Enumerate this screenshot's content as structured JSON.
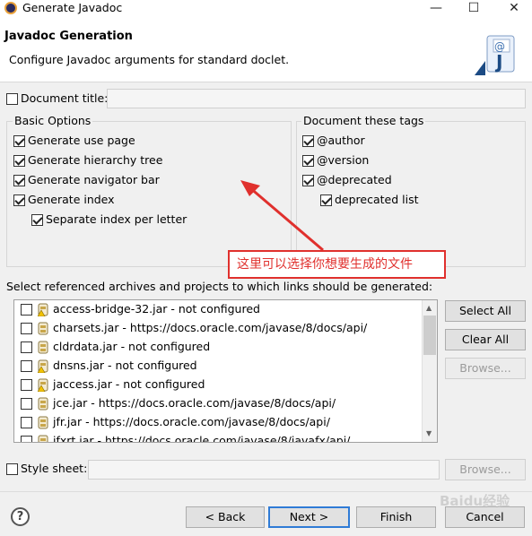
{
  "window": {
    "title": "Generate Javadoc",
    "minimize": "—",
    "maximize": "☐",
    "close": "✕"
  },
  "header": {
    "title": "Javadoc Generation",
    "description": "Configure Javadoc arguments for standard doclet."
  },
  "doc_title": {
    "label": "Document title:",
    "value": ""
  },
  "basic_options": {
    "legend": "Basic Options",
    "items": [
      {
        "label": "Generate use page",
        "checked": true
      },
      {
        "label": "Generate hierarchy tree",
        "checked": true
      },
      {
        "label": "Generate navigator bar",
        "checked": true
      },
      {
        "label": "Generate index",
        "checked": true
      },
      {
        "label": "Separate index per letter",
        "checked": true
      }
    ]
  },
  "doc_tags": {
    "legend": "Document these tags",
    "items": [
      {
        "label": "@author",
        "checked": true
      },
      {
        "label": "@version",
        "checked": true
      },
      {
        "label": "@deprecated",
        "checked": true
      },
      {
        "label": "deprecated list",
        "checked": true
      }
    ]
  },
  "annotation": {
    "text": "这里可以选择你想要生成的文件",
    "color": "#e0302d"
  },
  "archives": {
    "label": "Select referenced archives and projects to which links should be generated:",
    "items": [
      {
        "label": "access-bridge-32.jar - not configured",
        "icon": "jar-warning-icon"
      },
      {
        "label": "charsets.jar - https://docs.oracle.com/javase/8/docs/api/",
        "icon": "jar-icon"
      },
      {
        "label": "cldrdata.jar - not configured",
        "icon": "jar-icon"
      },
      {
        "label": "dnsns.jar - not configured",
        "icon": "jar-warning-icon"
      },
      {
        "label": "jaccess.jar - not configured",
        "icon": "jar-warning-icon"
      },
      {
        "label": "jce.jar - https://docs.oracle.com/javase/8/docs/api/",
        "icon": "jar-icon"
      },
      {
        "label": "jfr.jar - https://docs.oracle.com/javase/8/docs/api/",
        "icon": "jar-icon"
      },
      {
        "label": "jfxrt.jar - https://docs.oracle.com/javase/8/javafx/api/",
        "icon": "jar-icon"
      }
    ],
    "select_all": "Select All",
    "clear_all": "Clear All",
    "browse": "Browse..."
  },
  "style_sheet": {
    "label": "Style sheet:",
    "value": "",
    "browse": "Browse..."
  },
  "footer": {
    "back": "< Back",
    "next": "Next >",
    "finish": "Finish",
    "cancel": "Cancel",
    "help": "?"
  },
  "watermark": "Baidu经验"
}
